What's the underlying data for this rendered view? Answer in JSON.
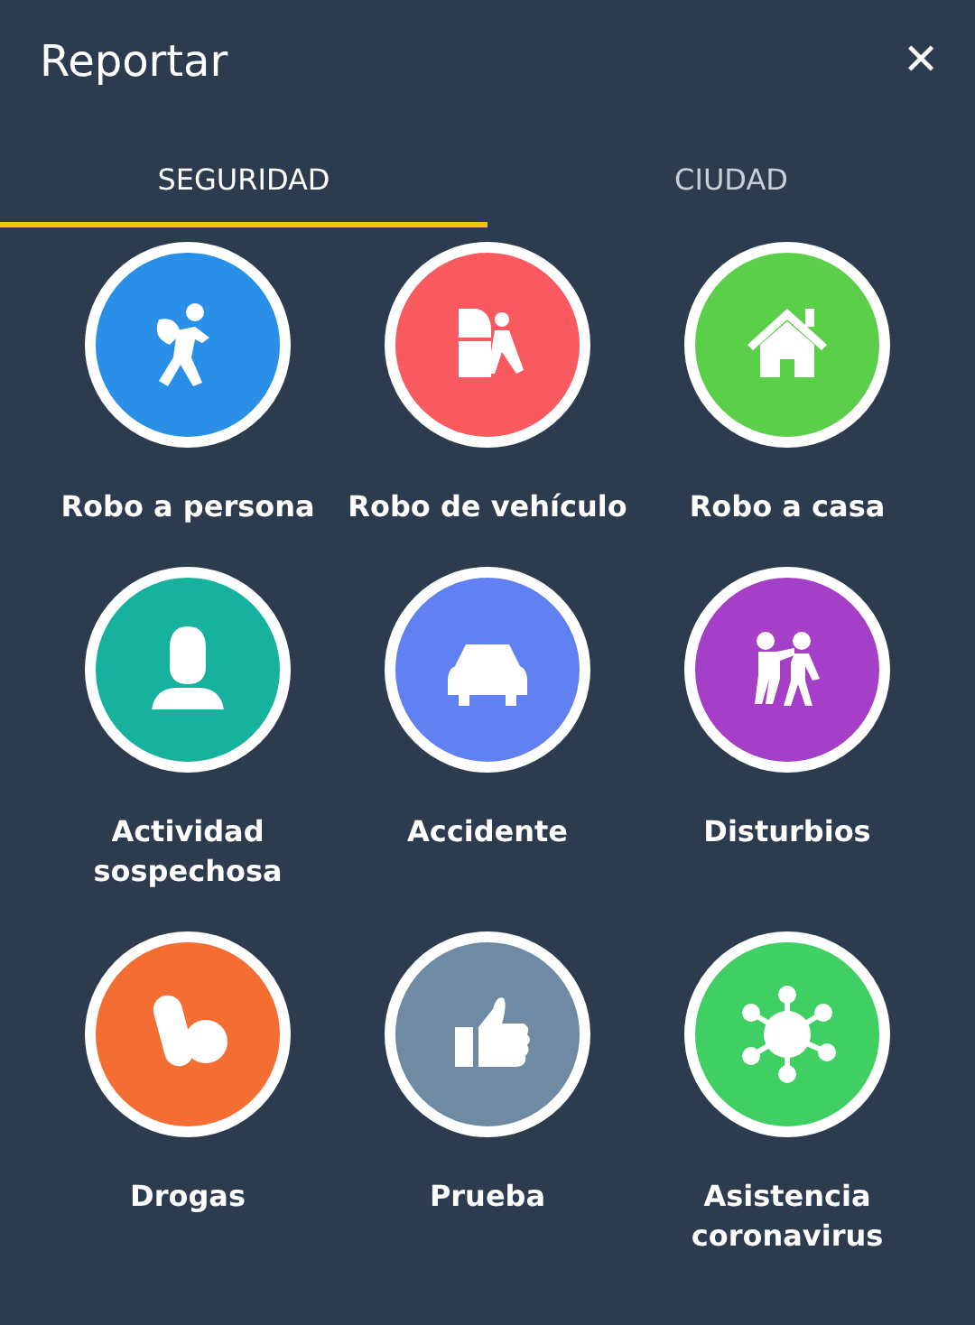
{
  "header": {
    "title": "Reportar",
    "close": "✕"
  },
  "tabs": [
    {
      "label": "SEGURIDAD",
      "selected": true
    },
    {
      "label": "CIUDAD",
      "selected": false
    }
  ],
  "items": [
    {
      "label": "Robo a persona",
      "kind": "thief",
      "color": "#2a8fe6"
    },
    {
      "label": "Robo de vehículo",
      "kind": "cartheft",
      "color": "#f95a60"
    },
    {
      "label": "Robo a casa",
      "kind": "house",
      "color": "#5ccf4a"
    },
    {
      "label": "Actividad sospechosa",
      "kind": "masked",
      "color": "#17b29e"
    },
    {
      "label": "Accidente",
      "kind": "crash",
      "color": "#6180f2"
    },
    {
      "label": "Disturbios",
      "kind": "fight",
      "color": "#a63fc7"
    },
    {
      "label": "Drogas",
      "kind": "pills",
      "color": "#f46e33"
    },
    {
      "label": "Prueba",
      "kind": "thumb",
      "color": "#6f8ba3"
    },
    {
      "label": "Asistencia coronavirus",
      "kind": "virus",
      "color": "#3fcf63"
    }
  ]
}
